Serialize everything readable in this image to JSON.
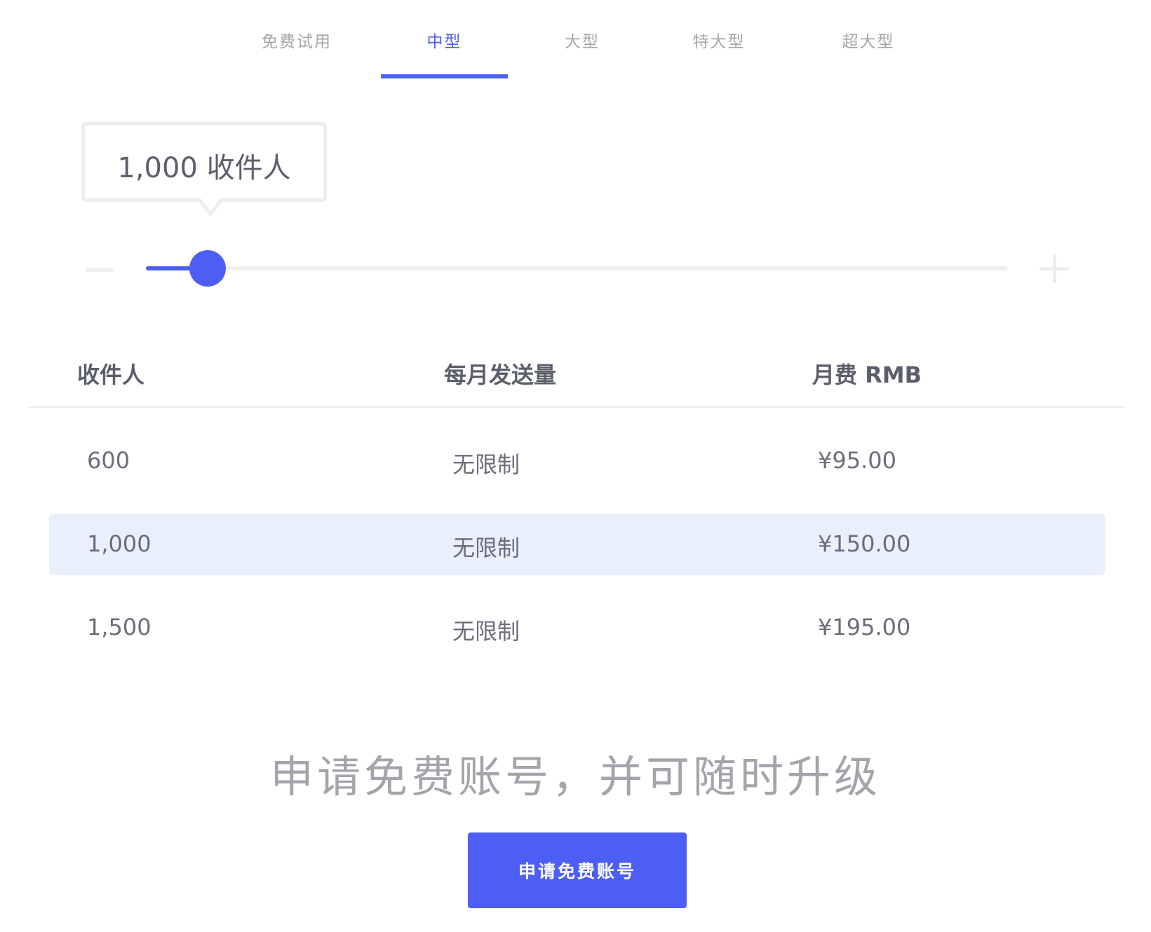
{
  "tabs": [
    {
      "label": "免费试用",
      "active": false
    },
    {
      "label": "中型",
      "active": true
    },
    {
      "label": "大型",
      "active": false
    },
    {
      "label": "特大型",
      "active": false
    },
    {
      "label": "超大型",
      "active": false
    }
  ],
  "slider": {
    "tooltip": "1,000 收件人",
    "value_fraction": 0.072
  },
  "colors": {
    "accent": "#4d5ef5",
    "highlight_row": "#e9f0fc",
    "muted_text": "#a3a5ab"
  },
  "table": {
    "headers": [
      "收件人",
      "每月发送量",
      "月费 RMB"
    ],
    "rows": [
      {
        "recipients": "600",
        "monthly": "无限制",
        "price": "¥95.00",
        "highlighted": false
      },
      {
        "recipients": "1,000",
        "monthly": "无限制",
        "price": "¥150.00",
        "highlighted": true
      },
      {
        "recipients": "1,500",
        "monthly": "无限制",
        "price": "¥195.00",
        "highlighted": false
      }
    ]
  },
  "cta": {
    "heading": "申请免费账号，并可随时升级",
    "button_label": "申请免费账号"
  }
}
